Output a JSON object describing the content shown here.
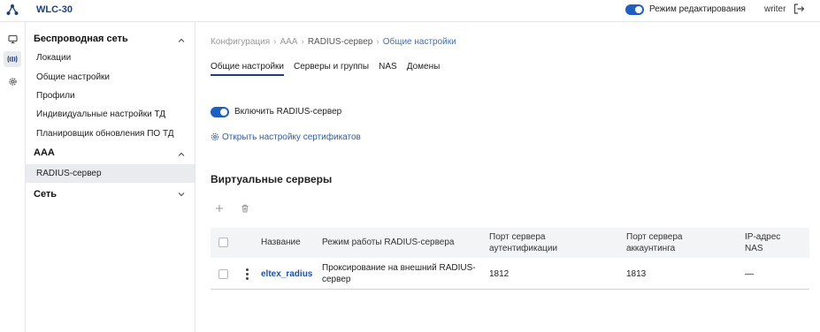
{
  "app": {
    "title": "WLC-30"
  },
  "topbar": {
    "edit_mode_label": "Режим редактирования",
    "user": "writer",
    "edit_mode_on": true
  },
  "sidebar": {
    "groups": [
      {
        "label": "Беспроводная сеть",
        "expanded": true,
        "items": [
          {
            "label": "Локации"
          },
          {
            "label": "Общие настройки"
          },
          {
            "label": "Профили"
          },
          {
            "label": "Индивидуальные настройки ТД"
          },
          {
            "label": "Планировщик обновления ПО ТД"
          }
        ]
      },
      {
        "label": "AAA",
        "expanded": true,
        "items": [
          {
            "label": "RADIUS-сервер",
            "selected": true
          }
        ]
      },
      {
        "label": "Сеть",
        "expanded": false,
        "items": []
      }
    ]
  },
  "breadcrumb": [
    "Конфигурация",
    "AAA",
    "RADIUS-сервер",
    "Общие настройки"
  ],
  "breadcrumb_sep": "›",
  "tabs": [
    {
      "label": "Общие настройки",
      "active": true
    },
    {
      "label": "Серверы и группы"
    },
    {
      "label": "NAS"
    },
    {
      "label": "Домены"
    }
  ],
  "radius": {
    "enable_label": "Включить RADIUS-сервер",
    "enabled": true
  },
  "cert_link": "Открыть настройку сертификатов",
  "virtual_servers": {
    "title": "Виртуальные серверы",
    "columns": [
      "Название",
      "Режим работы RADIUS-сервера",
      "Порт сервера аутентификации",
      "Порт сервера аккаунтинга",
      "IP-адрес NAS"
    ],
    "rows": [
      {
        "name": "eltex_radius",
        "mode": "Проксирование на внешний RADIUS-сервер",
        "auth_port": "1812",
        "acct_port": "1813",
        "nas_ip": "—"
      }
    ]
  },
  "colors": {
    "accent": "#1f5fbf",
    "brand_text": "#1d3f7a",
    "link": "#2b5ea8"
  }
}
